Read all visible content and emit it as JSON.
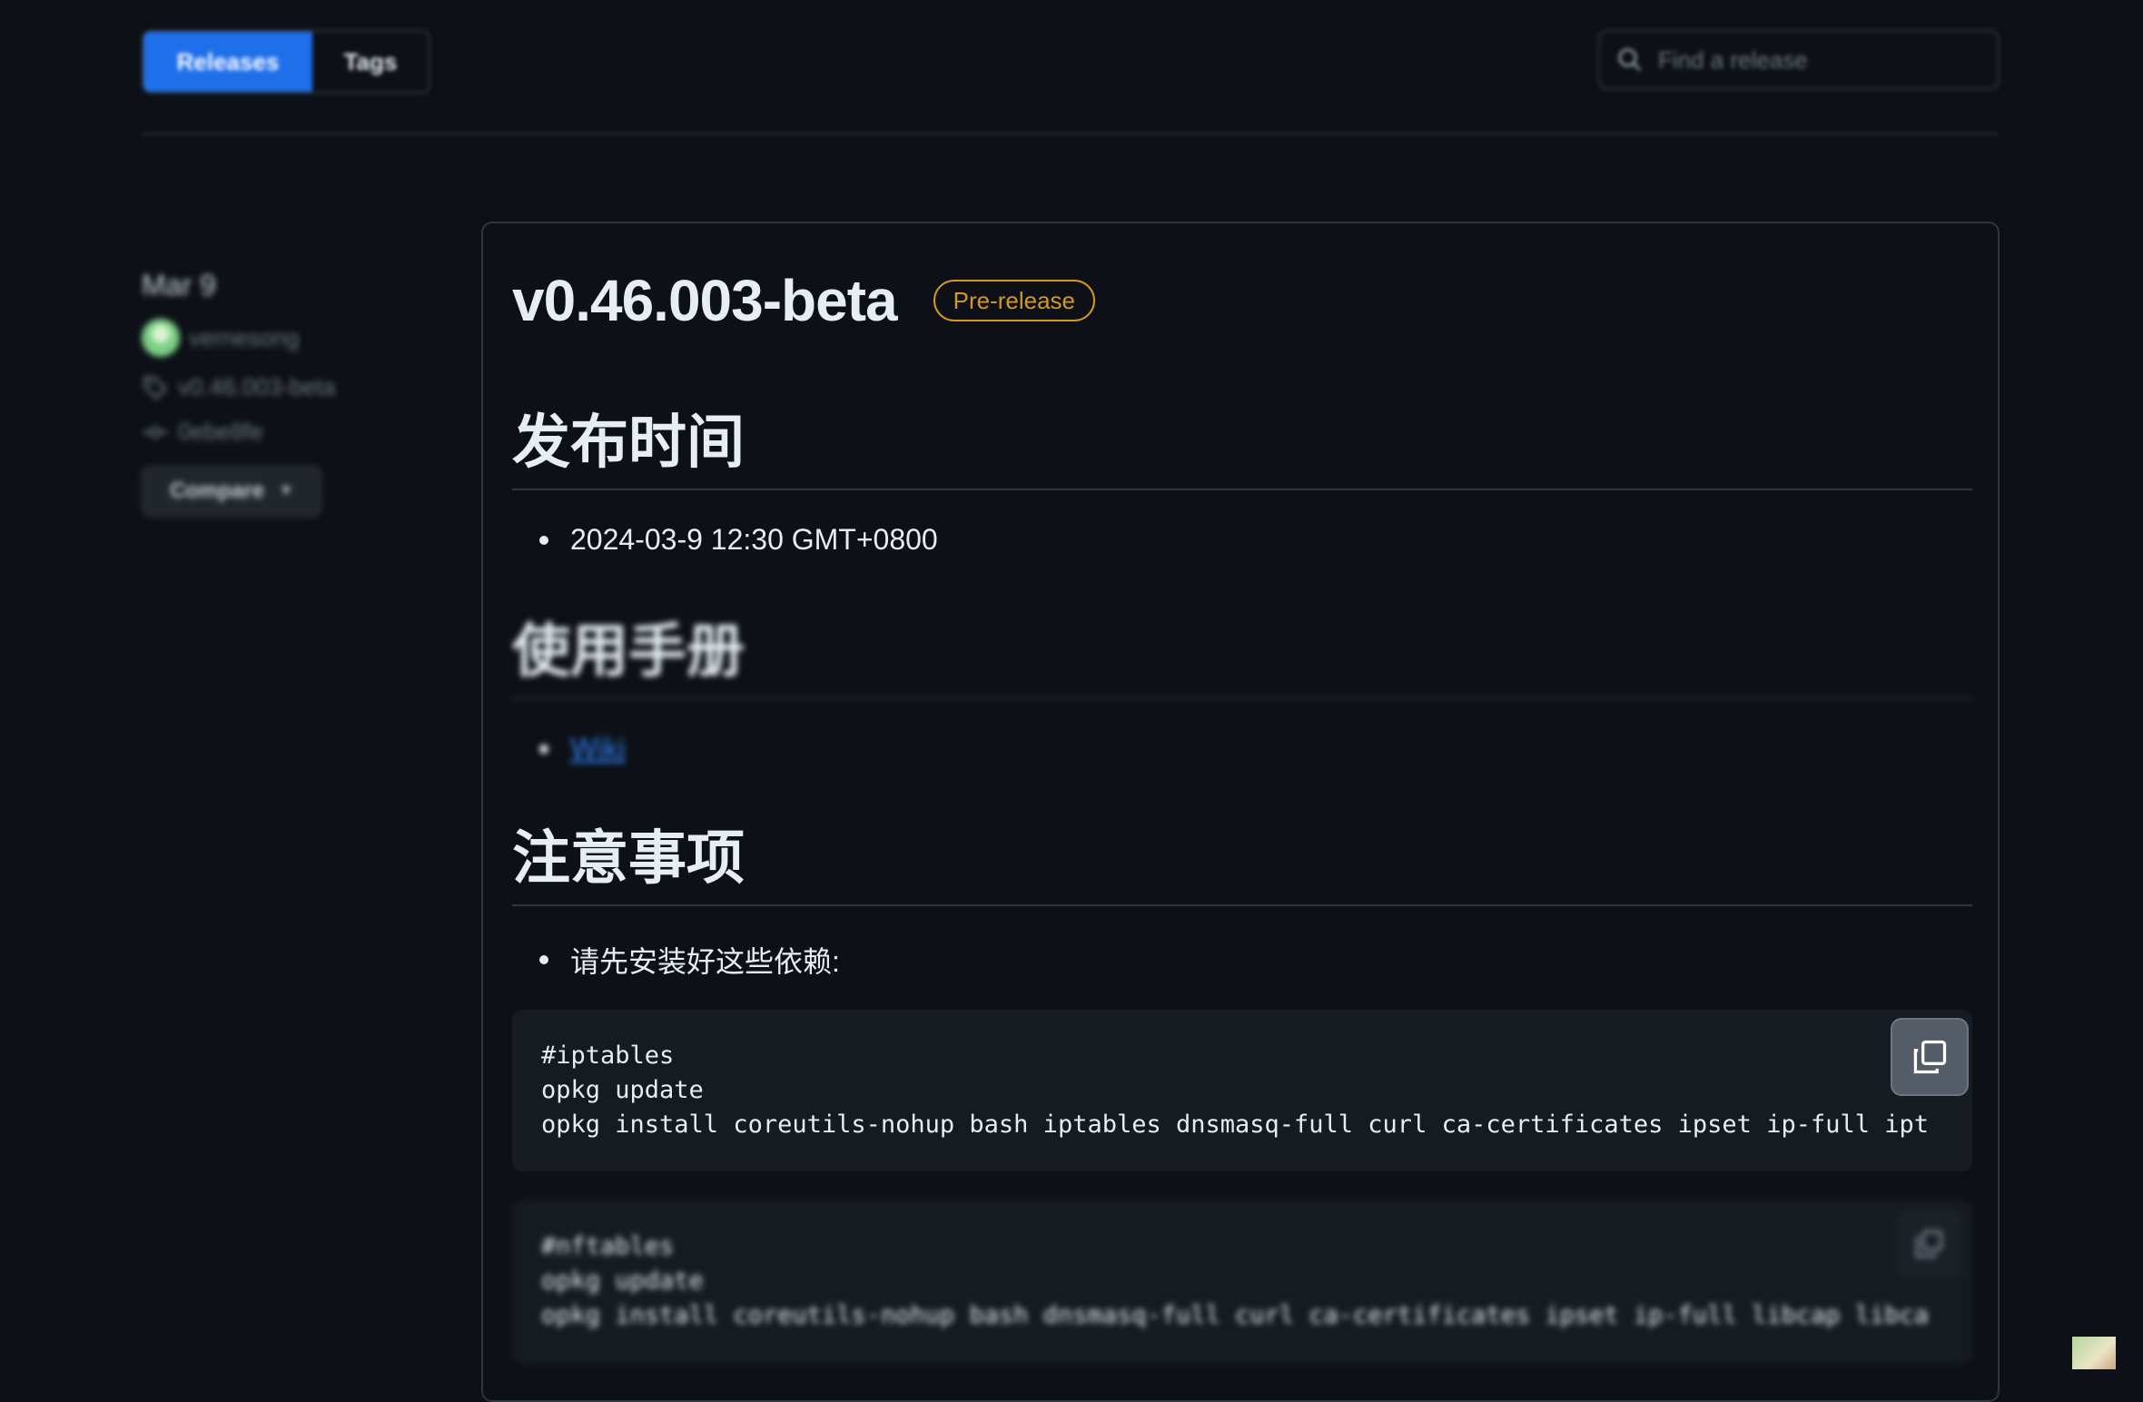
{
  "tabs": {
    "releases": "Releases",
    "tags": "Tags"
  },
  "search": {
    "placeholder": "Find a release"
  },
  "meta": {
    "date": "Mar 9",
    "author": "vernesong",
    "tag": "v0.46.003-beta",
    "commit": "0ebe8fe",
    "compare_label": "Compare"
  },
  "release": {
    "title": "v0.46.003-beta",
    "badge": "Pre-release",
    "sections": {
      "publish_time": {
        "heading": "发布时间",
        "item": "2024-03-9 12:30 GMT+0800"
      },
      "manual": {
        "heading": "使用手册",
        "link": "Wiki"
      },
      "notes": {
        "heading": "注意事项",
        "item": "请先安装好这些依赖:"
      }
    },
    "code_blocks": [
      {
        "line1": "#iptables",
        "line2": "opkg update",
        "line3": "opkg install coreutils-nohup bash iptables dnsmasq-full curl ca-certificates ipset ip-full ipt"
      },
      {
        "line1": "#nftables",
        "line2": "opkg update",
        "line3": "opkg install coreutils-nohup bash dnsmasq-full curl ca-certificates ipset ip-full libcap libca"
      }
    ]
  },
  "colors": {
    "background": "#0d1117",
    "accent": "#1f6feb",
    "prerelease": "#d29922",
    "link": "#2f81f7"
  }
}
